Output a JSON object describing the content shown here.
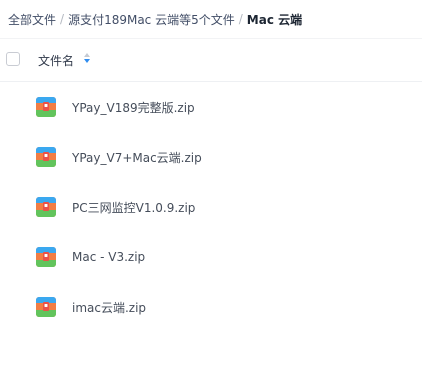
{
  "breadcrumb": {
    "items": [
      "全部文件",
      "源支付189Mac 云端等5个文件"
    ],
    "separator": "/",
    "current": "Mac 云端"
  },
  "header": {
    "name_label": "文件名"
  },
  "files": [
    {
      "name": "YPay_V189完整版.zip",
      "icon": "zip-archive-icon"
    },
    {
      "name": "YPay_V7+Mac云端.zip",
      "icon": "zip-archive-icon"
    },
    {
      "name": "PC三网监控V1.0.9.zip",
      "icon": "zip-archive-icon"
    },
    {
      "name": "Mac - V3.zip",
      "icon": "zip-archive-icon"
    },
    {
      "name": "imac云端.zip",
      "icon": "zip-archive-icon"
    }
  ],
  "colors": {
    "sort_active": "#2f8cf0",
    "zip_blue": "#3aa8f0",
    "zip_green": "#62c45c",
    "zip_orange": "#f27d44",
    "zip_red": "#e9514a"
  }
}
